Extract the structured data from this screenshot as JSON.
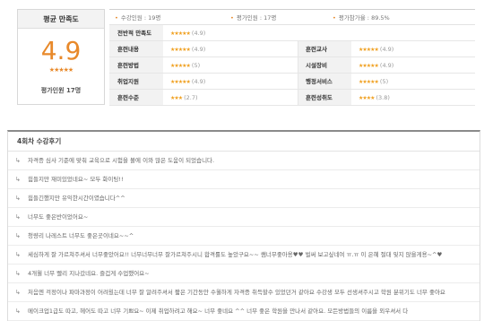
{
  "summary": {
    "title": "평균 만족도",
    "score": "4.9",
    "stars": "★★★★★",
    "count": "평가인원 17명"
  },
  "stats": {
    "students": "수강인원 : 19명",
    "raters": "평가인원 : 17명",
    "rate": "평가참가율 : 89.5%"
  },
  "ratings": {
    "overall": {
      "label": "전반적 만족도",
      "stars": "★★★★★",
      "value": "(4.9)"
    },
    "rows": [
      {
        "l1": "훈련내용",
        "s1": "★★★★★",
        "v1": "(4.9)",
        "l2": "훈련교사",
        "s2": "★★★★★",
        "v2": "(4.9)"
      },
      {
        "l1": "훈련방법",
        "s1": "★★★★★",
        "v1": "(5)",
        "l2": "시설장비",
        "s2": "★★★★★",
        "v2": "(4.9)"
      },
      {
        "l1": "취업지원",
        "s1": "★★★★★",
        "v1": "(4.9)",
        "l2": "행정서비스",
        "s2": "★★★★★",
        "v2": "(5)"
      },
      {
        "l1": "훈련수준",
        "s1": "★★★",
        "v1": "(2.7)",
        "l2": "훈련성취도",
        "s2": "★★★★",
        "v2": "(3.8)"
      }
    ]
  },
  "reviews": {
    "title": "4회차 수강후기",
    "items": [
      "자격증 심사 기준에 맞춰 교육으로 시험을 볼에 이와 많은 도움이 되었습니다.",
      "힘들지만 재미있었네요~ 모두 화이팅!!",
      "힘들긴했지만 유익한시간이였습니다^^",
      "너무도 좋은반이었어요~",
      "청량리 나레스트 너무도 좋은곳이네요~~^",
      "세심하게 잘 가르쳐주셔서 너무좋았어요!! 너무너무너무 잘가르쳐주시니 합격률도 높았구요~~ 쌤너무좋아용♥♥ 벌써 보고싶네여 ㅠ.ㅠ 이 은혜 절대 잊지 않을게용~^♥",
      "4개월 너무 빨리 지나갔네요. 즐겁게 수업했어요~",
      "처음엔 걱정이나 파마과정이 어려웠는데 너무 잘 알려주셔서 짧은 기간동안 수월하게 자격증 취득할수 있었던거 같아요 수강생 모두 선생셔주시고 학원 분위기도 너무 좋아요",
      "메이크업1급도 따고, 헤어도 따고 너무 기쁘요~ 이제 취업하려고 해요~ 너무 좋네요 ^^ 너무 좋은 학원을 만나서 같아요. 모든방법들의 이름을 외우셔서 다"
    ]
  }
}
